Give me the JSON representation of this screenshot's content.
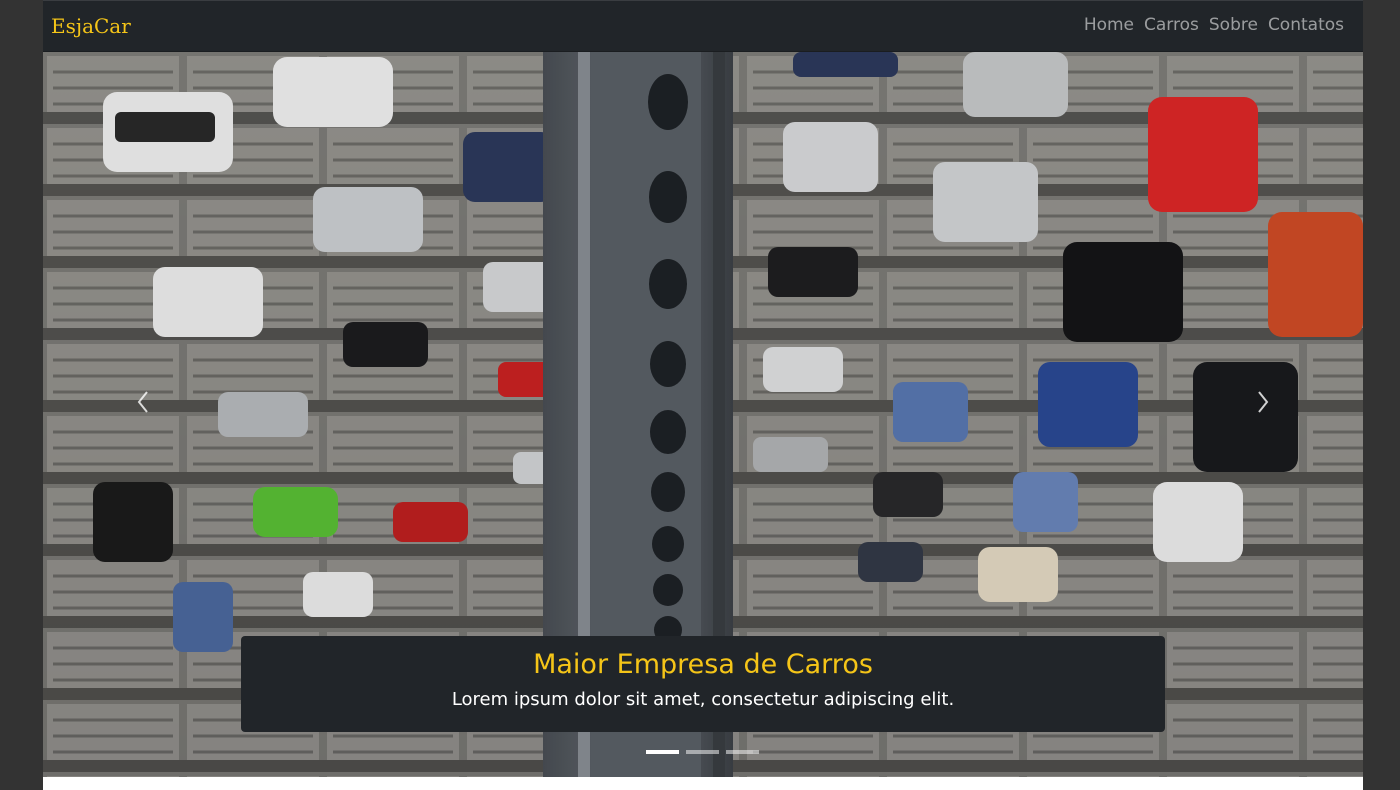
{
  "navbar": {
    "brand": "EsjaCar",
    "links": [
      "Home",
      "Carros",
      "Sobre",
      "Contatos"
    ]
  },
  "carousel": {
    "slide_count": 3,
    "active_slide": 1,
    "caption": {
      "title": "Maior Empresa de Carros",
      "text": "Lorem ipsum dolor sit amet, consectetur adipiscing elit."
    }
  },
  "colors": {
    "brand": "#f5c518",
    "navbar_bg": "#212529",
    "caption_bg": "#212529"
  },
  "icons": [
    "chevron-left-icon",
    "chevron-right-icon"
  ]
}
